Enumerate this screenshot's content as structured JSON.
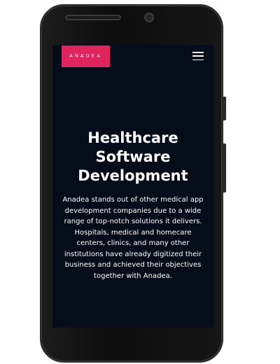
{
  "site": {
    "logo_text": "ANADEA",
    "brand_color": "#e0245e",
    "background_color": "#050d1a"
  },
  "header": {
    "menu_icon": "hamburger-menu-icon"
  },
  "hero": {
    "title": "Healthcare\nSoftware\nDevelopment",
    "description": "Anadea stands out of other medical app development companies due to a wide range of top-notch solutions it delivers. Hospitals, medical and homecare centers, clinics, and many other institutions have already digitized their business and achieved their objectives together with Anadea."
  }
}
